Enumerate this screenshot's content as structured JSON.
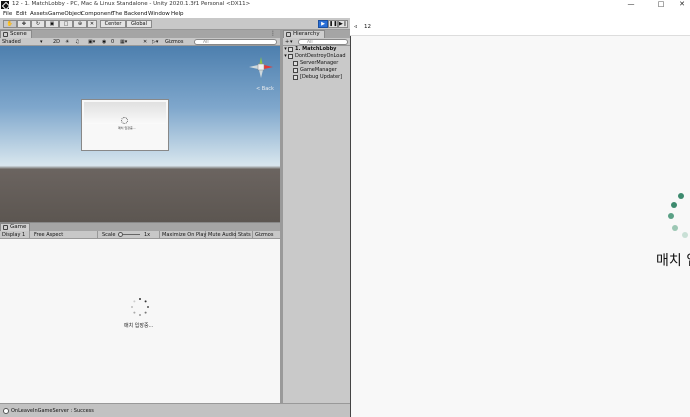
{
  "window": {
    "title": "12 - 1. MatchLobby - PC, Mac & Linux Standalone - Unity 2020.1.3f1 Personal <DX11>",
    "minimize": "—",
    "maximize": "□",
    "close": "✕"
  },
  "menu": [
    "File",
    "Edit",
    "Assets",
    "GameObject",
    "Component",
    "The Backend",
    "Window",
    "Help"
  ],
  "toolbar": {
    "center": "Center",
    "global": "Global"
  },
  "scene": {
    "tab_label": "Scene",
    "shading": "Shaded",
    "mode_2d": "2D",
    "gizmos": "Gizmos",
    "search_placeholder": "All",
    "layer_count": "0",
    "perspective": "< Back",
    "canvas_text": "매치 입장중..."
  },
  "game": {
    "tab_label": "Game",
    "display": "Display 1",
    "aspect": "Free Aspect",
    "scale_label": "Scale",
    "scale_value": "1x",
    "maximize_on_play": "Maximize On Play",
    "mute_audio": "Mute Audio",
    "stats": "Stats",
    "gizmos": "Gizmos",
    "loading_text": "매치 입장중..."
  },
  "hierarchy": {
    "tab_label": "Hierarchy",
    "add": "+",
    "search_placeholder": "All",
    "items": [
      {
        "label": "1. MatchLobby"
      },
      {
        "label": "DontDestroyOnLoad"
      },
      {
        "label": "ServerManager"
      },
      {
        "label": "GameManager"
      },
      {
        "label": "[Debug Updater]"
      }
    ]
  },
  "player": {
    "number": "12",
    "loading_text": "매치 입"
  },
  "status": {
    "message": "OnLeaveInGameServer : Success"
  },
  "colors": {
    "accent": "#2a6fd6",
    "spinner": "#3d8a6e"
  }
}
